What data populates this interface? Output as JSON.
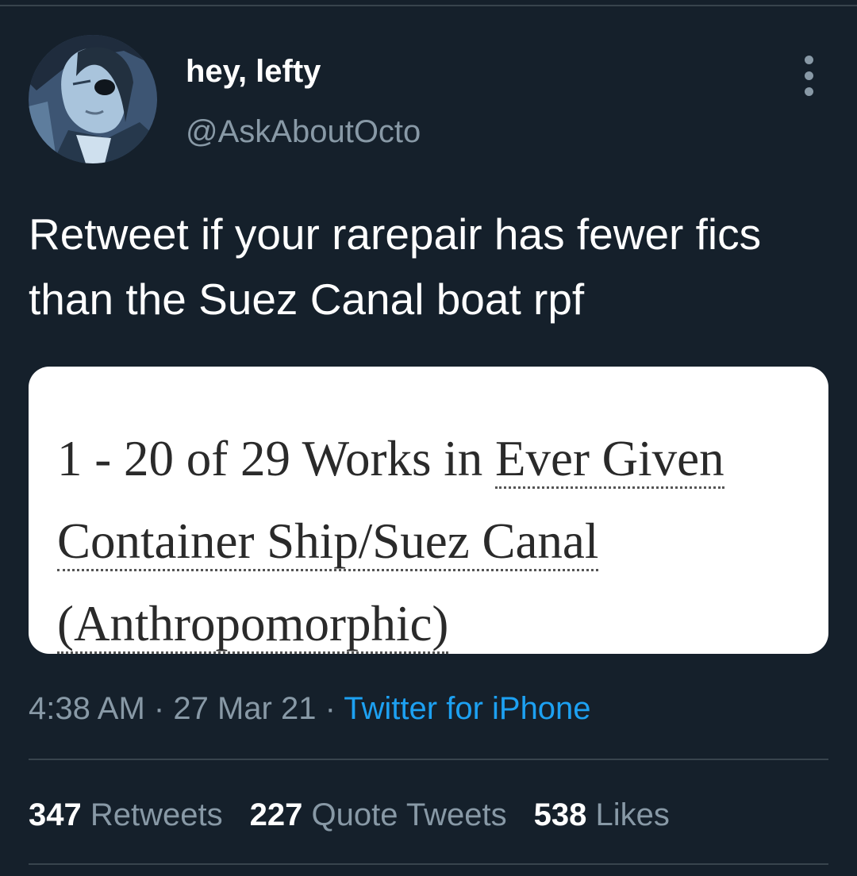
{
  "colors": {
    "background": "#15202b",
    "primary_text": "#ffffff",
    "secondary_text": "#8899a6",
    "link": "#1da1f2",
    "divider": "#38444d"
  },
  "author": {
    "display_name": "hey, lefty",
    "handle": "@AskAboutOcto",
    "avatar_icon": "profile-avatar"
  },
  "menu": {
    "icon": "more-options-icon"
  },
  "tweet": {
    "text": "Retweet if your rarepair has fewer fics than the Suez Canal boat rpf"
  },
  "media": {
    "heading_prefix": "1 - 20 of 29 Works in ",
    "fandom_tag": "Ever Given Container Ship/Suez Canal (Anthropomorphic)"
  },
  "meta": {
    "time": "4:38 AM",
    "separator": "·",
    "date": "27 Mar 21",
    "source": "Twitter for iPhone"
  },
  "stats": {
    "retweets_count": "347",
    "retweets_label": "Retweets",
    "quote_tweets_count": "227",
    "quote_tweets_label": "Quote Tweets",
    "likes_count": "538",
    "likes_label": "Likes"
  }
}
